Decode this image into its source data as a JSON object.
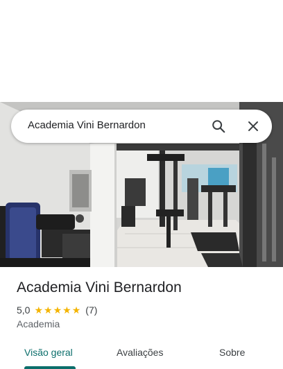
{
  "search": {
    "query": "Academia Vini Bernardon",
    "search_icon": "search-icon",
    "close_icon": "close-icon"
  },
  "place": {
    "name": "Academia Vini Bernardon",
    "rating": "5,0",
    "stars": 5,
    "review_count": "(7)",
    "category": "Academia",
    "photo": "gym-interior-photo"
  },
  "tabs": [
    {
      "label": "Visão geral",
      "active": true
    },
    {
      "label": "Avaliações",
      "active": false
    },
    {
      "label": "Sobre",
      "active": false
    }
  ],
  "colors": {
    "accent": "#0b6e6b",
    "star": "#f4b400",
    "text": "#202124"
  }
}
